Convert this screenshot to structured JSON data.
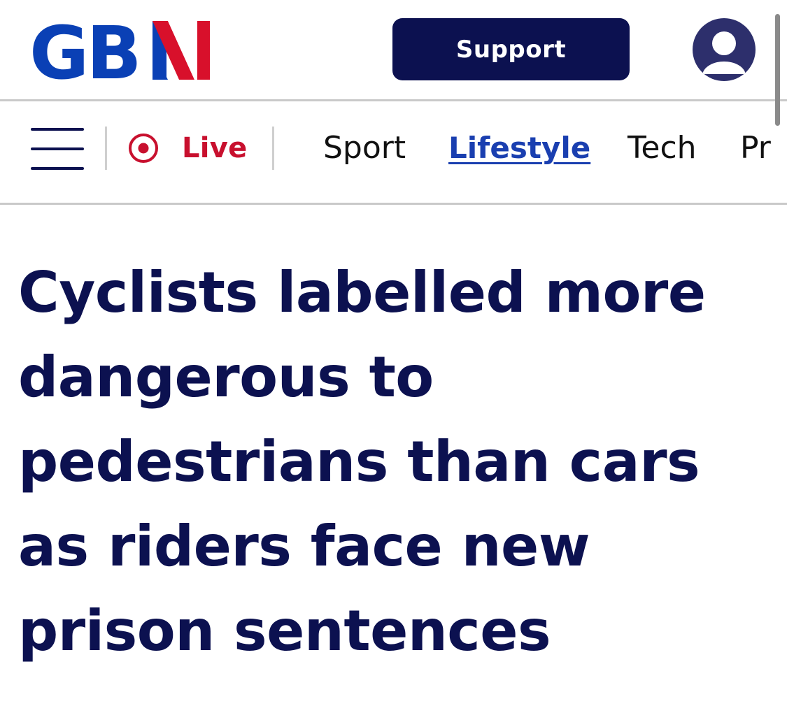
{
  "header": {
    "logo_text": "GBN",
    "support_label": "Support",
    "avatar_icon": "user-icon",
    "colors": {
      "brand_navy": "#0c1150",
      "logo_blue": "#0a40b5",
      "logo_red": "#d8102b"
    }
  },
  "nav": {
    "menu_icon": "hamburger-icon",
    "live_icon": "live-record-icon",
    "live_label": "Live",
    "live_color": "#c8102e",
    "items": [
      {
        "label": "Sport",
        "active": false
      },
      {
        "label": "Lifestyle",
        "active": true
      },
      {
        "label": "Tech",
        "active": false
      },
      {
        "label": "Pr",
        "active": false
      }
    ],
    "active_color": "#1a3fb0"
  },
  "article": {
    "headline": "Cyclists labelled more dangerous to pedestrians than cars as riders face new prison sentences"
  }
}
